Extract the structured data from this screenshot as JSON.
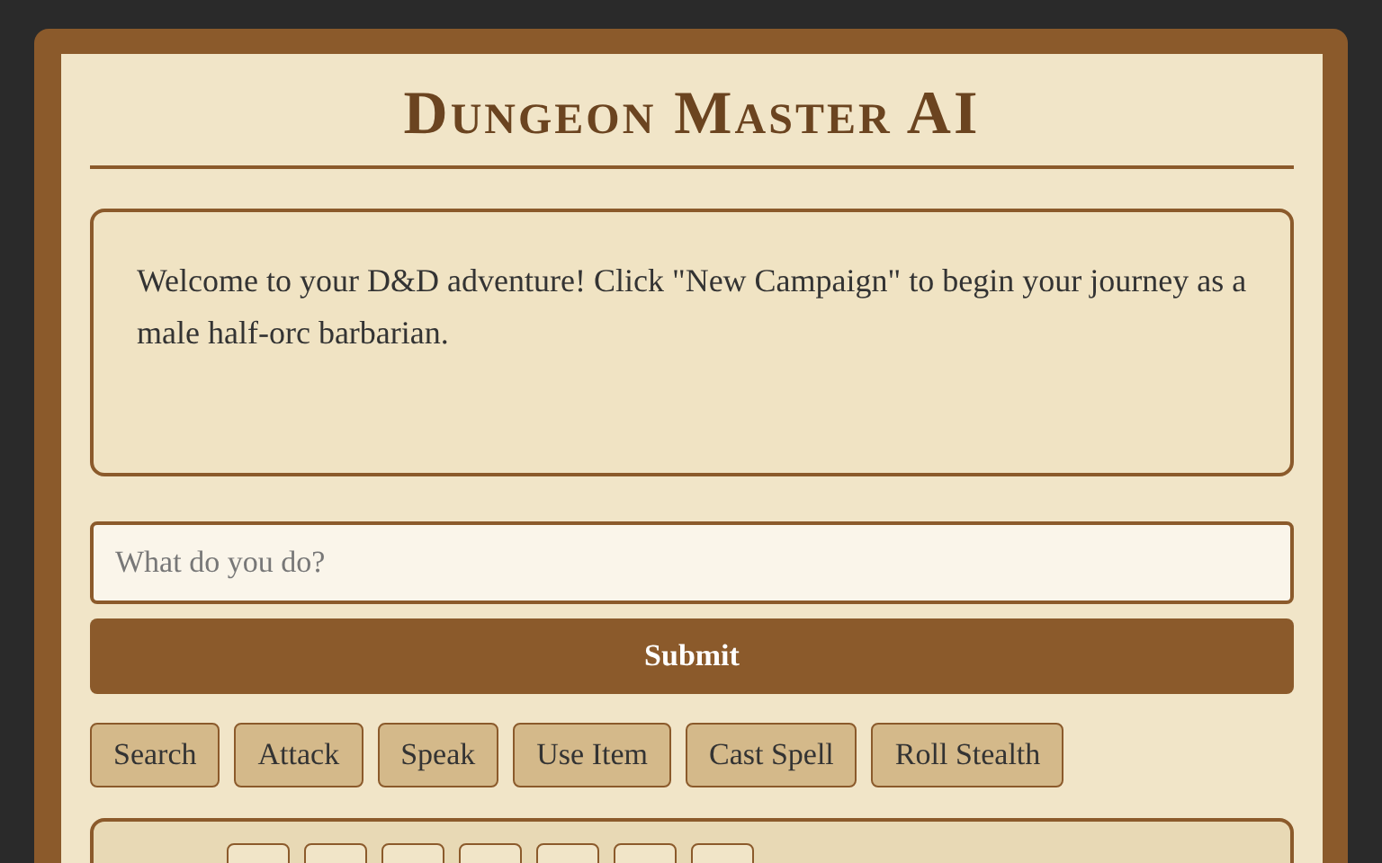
{
  "title": "Dungeon Master AI",
  "story": "Welcome to your D&D adventure! Click \"New Campaign\" to begin your journey as a male half-orc barbarian.",
  "command": {
    "placeholder": "What do you do?"
  },
  "submit": "Submit",
  "actions": [
    "Search",
    "Attack",
    "Speak",
    "Use Item",
    "Cast Spell",
    "Roll Stealth"
  ]
}
